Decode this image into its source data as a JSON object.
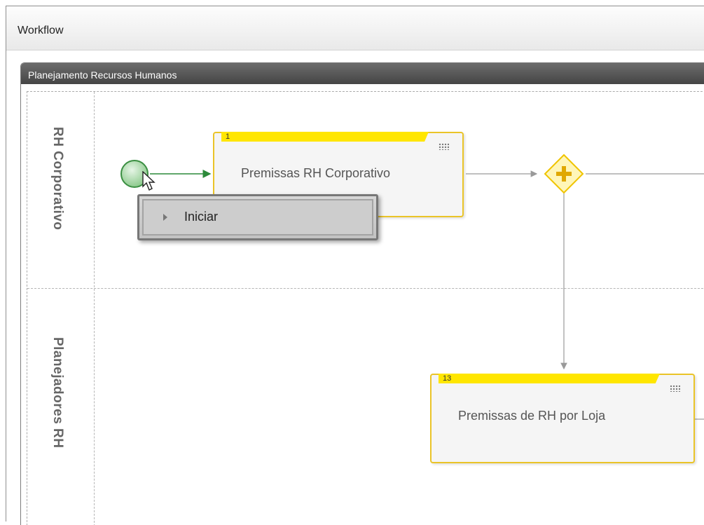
{
  "window": {
    "title": "Workflow"
  },
  "panel": {
    "title": "Planejamento Recursos Humanos"
  },
  "lanes": [
    {
      "label": "RH Corporativo"
    },
    {
      "label": "Planejadores RH"
    }
  ],
  "tasks": [
    {
      "id_label": "1",
      "label": "Premissas RH Corporativo"
    },
    {
      "id_label": "13",
      "label": "Premissas de RH por Loja"
    }
  ],
  "context_menu": {
    "item_label": "Iniciar"
  },
  "colors": {
    "task_border": "#eac428",
    "task_tag": "#ffe600",
    "start_event": "#3b8f42",
    "gateway": "#ffd200"
  }
}
